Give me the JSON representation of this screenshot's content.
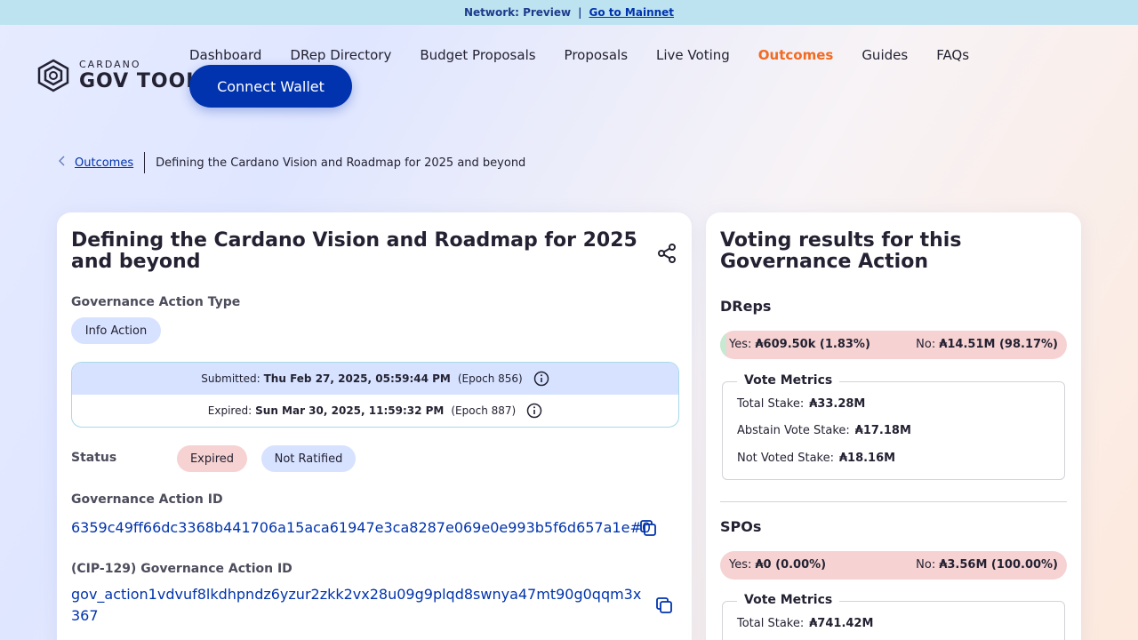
{
  "topbar": {
    "network": "Network: Preview",
    "separator": "|",
    "mainnet_link": "Go to Mainnet"
  },
  "logo": {
    "small": "CARDANO",
    "big": "GOV TOOL"
  },
  "nav": {
    "items": [
      "Dashboard",
      "DRep Directory",
      "Budget Proposals",
      "Proposals",
      "Live Voting",
      "Outcomes",
      "Guides",
      "FAQs"
    ],
    "active": "Outcomes"
  },
  "connect_label": "Connect Wallet",
  "breadcrumb": {
    "link": "Outcomes",
    "current": "Defining the Cardano Vision and Roadmap for 2025 and beyond"
  },
  "details": {
    "title": "Defining the Cardano Vision and Roadmap for 2025 and beyond",
    "type_label": "Governance Action Type",
    "type_value": "Info Action",
    "submitted_label": "Submitted:",
    "submitted_value": "Thu Feb 27, 2025, 05:59:44 PM",
    "submitted_epoch": "(Epoch 856)",
    "expired_label": "Expired:",
    "expired_value": "Sun Mar 30, 2025, 11:59:32 PM",
    "expired_epoch": "(Epoch 887)",
    "status_label": "Status",
    "status_badges": [
      "Expired",
      "Not Ratified"
    ],
    "id_label": "Governance Action ID",
    "id_value": "6359c49ff66dc3368b441706a15aca61947e3ca8287e069e0e993b5f6d657a1e#0",
    "cip_label": "(CIP-129) Governance Action ID",
    "cip_value": "gov_action1vdvuf8lkdhpndz6yzur2zkk2vx28u09g9plqd8swnya47mt90g0qqm3x367"
  },
  "results": {
    "title": "Voting results for this Governance Action",
    "dreps": {
      "heading": "DReps",
      "yes_label": "Yes:",
      "yes_value": "₳609.50k (1.83%)",
      "no_label": "No:",
      "no_value": "₳14.51M (98.17%)",
      "yes_fraction": 0.0183,
      "metrics_title": "Vote Metrics",
      "metrics": [
        {
          "label": "Total Stake:",
          "value": "₳33.28M"
        },
        {
          "label": "Abstain Vote Stake:",
          "value": "₳17.18M"
        },
        {
          "label": "Not Voted Stake:",
          "value": "₳18.16M"
        }
      ]
    },
    "spos": {
      "heading": "SPOs",
      "yes_label": "Yes:",
      "yes_value": "₳0 (0.00%)",
      "no_label": "No:",
      "no_value": "₳3.56M (100.00%)",
      "yes_fraction": 0,
      "metrics_title": "Vote Metrics",
      "metrics": [
        {
          "label": "Total Stake:",
          "value": "₳741.42M"
        }
      ]
    }
  },
  "colors": {
    "primary": "#0033ad",
    "active_nav": "#f26a21",
    "no_bar": "#f6d2d2",
    "yes_bar": "#c6ead1"
  }
}
